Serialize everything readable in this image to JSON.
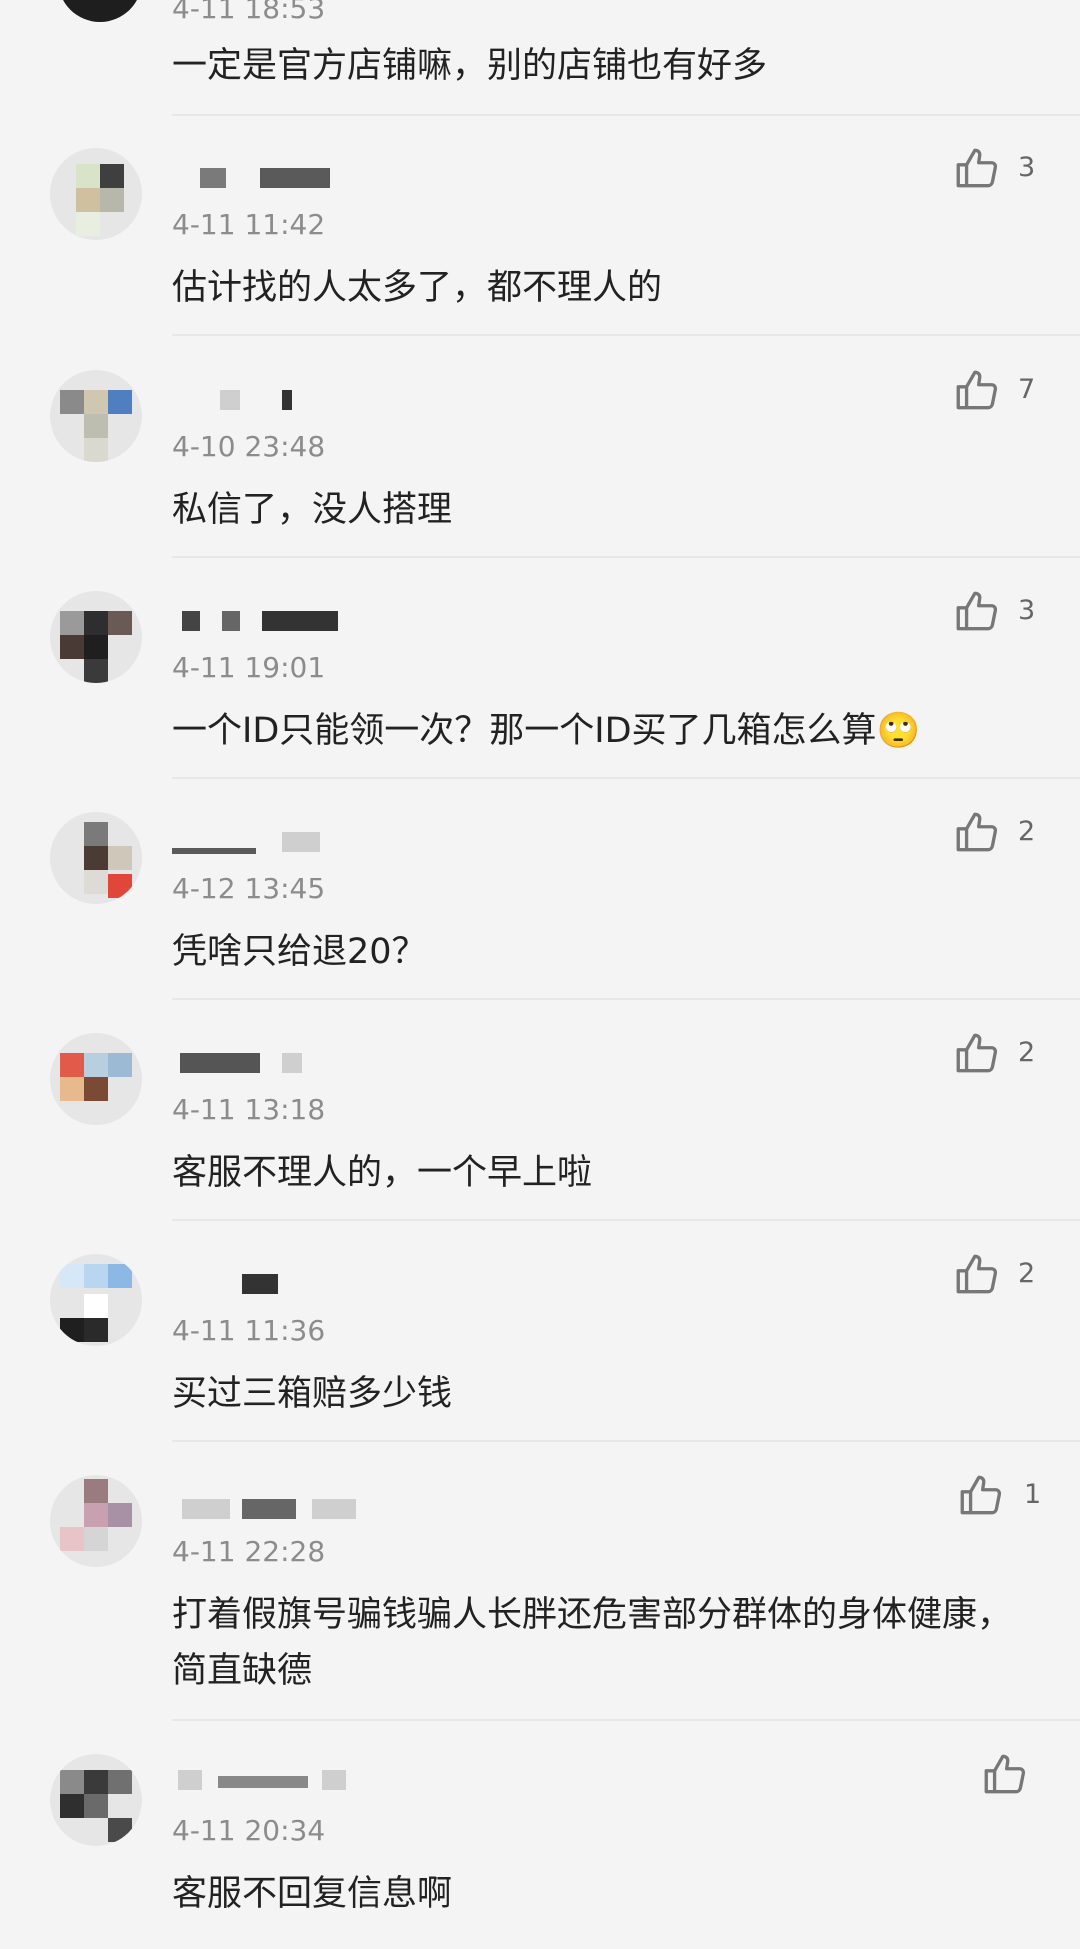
{
  "comments": [
    {
      "user": "",
      "time": "4-11 18:53",
      "text": "一定是官方店铺嘛，别的店铺也有好多",
      "likes": ""
    },
    {
      "user": "",
      "time": "4-11 11:42",
      "text": "估计找的人太多了，都不理人的",
      "likes": "3"
    },
    {
      "user": "",
      "time": "4-10 23:48",
      "text": "私信了，没人搭理",
      "likes": "7"
    },
    {
      "user": "",
      "time": "4-11 19:01",
      "text": "一个ID只能领一次？那一个ID买了几箱怎么算🙄",
      "likes": "3"
    },
    {
      "user": "",
      "time": "4-12 13:45",
      "text": "凭啥只给退20？",
      "likes": "2"
    },
    {
      "user": "",
      "time": "4-11 13:18",
      "text": "客服不理人的，一个早上啦",
      "likes": "2"
    },
    {
      "user": "",
      "time": "4-11 11:36",
      "text": "买过三箱赔多少钱",
      "likes": "2"
    },
    {
      "user": "",
      "time": "4-11 22:28",
      "text": "打着假旗号骗钱骗人长胖还危害部分群体的身体健康，简直缺德",
      "likes": "1"
    },
    {
      "user": "",
      "time": "4-11 20:34",
      "text": "客服不回复信息啊",
      "likes": ""
    }
  ],
  "icons": {
    "like": "thumbs-up-icon"
  },
  "colors": {
    "background": "#f4f4f4",
    "text": "#222222",
    "meta": "#8c8c8c"
  }
}
